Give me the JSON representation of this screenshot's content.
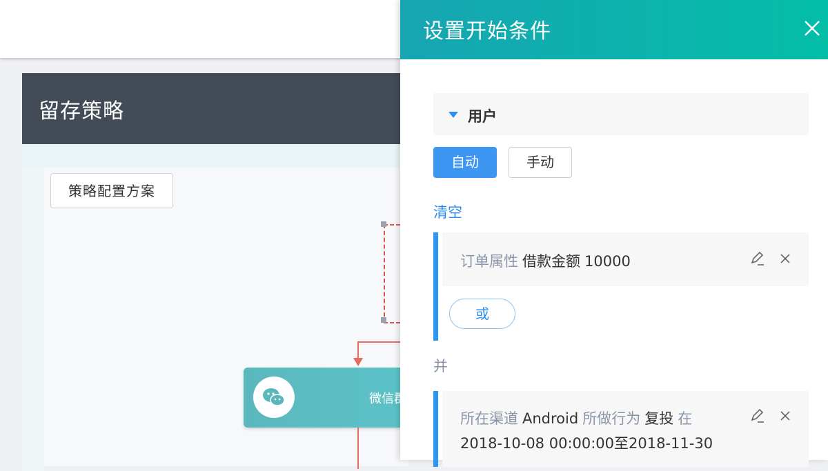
{
  "background": {
    "card_title": "留存策略",
    "plan_button_label": "策略配置方案",
    "wechat_node_label": "微信群"
  },
  "panel": {
    "title": "设置开始条件",
    "close_icon": "close-icon",
    "group_label": "用户",
    "mode_buttons": {
      "auto": "自动",
      "manual": "手动",
      "selected": "auto"
    },
    "clear_label": "清空",
    "condition1": {
      "field_label": "订单属性",
      "field": "借款金额",
      "value": "10000"
    },
    "or_label": "或",
    "and_label": "并",
    "condition2": {
      "channel_label": "所在渠道",
      "channel": "Android",
      "action_label": "所做行为",
      "action": "复投",
      "at_label": "在",
      "time_range": "2018-10-08 00:00:00至2018-11-30"
    }
  },
  "colors": {
    "header_gradient_start": "#17a5b3",
    "header_gradient_end": "#03bea7",
    "accent_blue": "#2d8ef0",
    "card_header": "#434b56",
    "flow_red": "#e86a60",
    "wechat_node": "#5ab8bd"
  }
}
